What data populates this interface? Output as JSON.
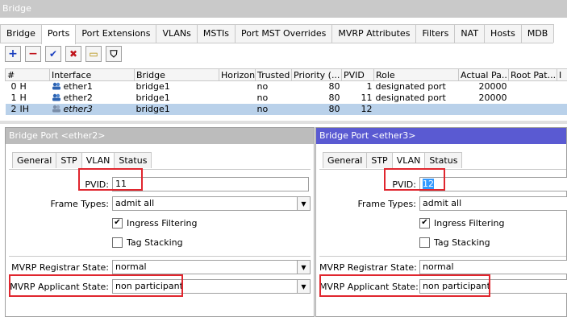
{
  "window": {
    "title": "Bridge"
  },
  "tabs": [
    "Bridge",
    "Ports",
    "Port Extensions",
    "VLANs",
    "MSTIs",
    "Port MST Overrides",
    "MVRP Attributes",
    "Filters",
    "NAT",
    "Hosts",
    "MDB"
  ],
  "toolbar": {
    "add": "+",
    "remove": "−",
    "enable": "✔",
    "disable": "✖",
    "comment": "▭",
    "filter": "⛉"
  },
  "table": {
    "columns": [
      "#",
      "Interface",
      "Bridge",
      "Horizon",
      "Trusted",
      "Priority (...",
      "PVID",
      "Role",
      "Actual Pa...",
      "Root Pat...",
      "I"
    ],
    "rows": [
      {
        "num": "0",
        "flags": "H",
        "interface": "ether1",
        "bridge": "bridge1",
        "horizon": "",
        "trusted": "no",
        "priority": "80",
        "pvid": "1",
        "role": "designated port",
        "actual_path": "20000",
        "root_path": ""
      },
      {
        "num": "1",
        "flags": "H",
        "interface": "ether2",
        "bridge": "bridge1",
        "horizon": "",
        "trusted": "no",
        "priority": "80",
        "pvid": "11",
        "role": "designated port",
        "actual_path": "20000",
        "root_path": ""
      },
      {
        "num": "2",
        "flags": "IH",
        "interface": "ether3",
        "bridge": "bridge1",
        "horizon": "",
        "trusted": "no",
        "priority": "80",
        "pvid": "12",
        "role": "",
        "actual_path": "",
        "root_path": ""
      }
    ]
  },
  "panel_left": {
    "title": "Bridge Port <ether2>",
    "tabs": [
      "General",
      "STP",
      "VLAN",
      "Status"
    ],
    "pvid_label": "PVID:",
    "pvid_value": "11",
    "frame_types_label": "Frame Types:",
    "frame_types_value": "admit all",
    "ingress_label": "Ingress Filtering",
    "tag_stacking_label": "Tag Stacking",
    "registrar_label": "MVRP Registrar State:",
    "registrar_value": "normal",
    "applicant_label": "MVRP Applicant State:",
    "applicant_value": "non participant"
  },
  "panel_right": {
    "title": "Bridge Port <ether3>",
    "tabs": [
      "General",
      "STP",
      "VLAN",
      "Status"
    ],
    "pvid_label": "PVID:",
    "pvid_value": "12",
    "frame_types_label": "Frame Types:",
    "frame_types_value": "admit all",
    "ingress_label": "Ingress Filtering",
    "tag_stacking_label": "Tag Stacking",
    "registrar_label": "MVRP Registrar State:",
    "registrar_value": "normal",
    "applicant_label": "MVRP Applicant State:",
    "applicant_value": "non participant"
  },
  "colors": {
    "highlight_box": "#e0262e",
    "active_title": "#5a5ad2",
    "selected_row": "#b9d1ea"
  }
}
